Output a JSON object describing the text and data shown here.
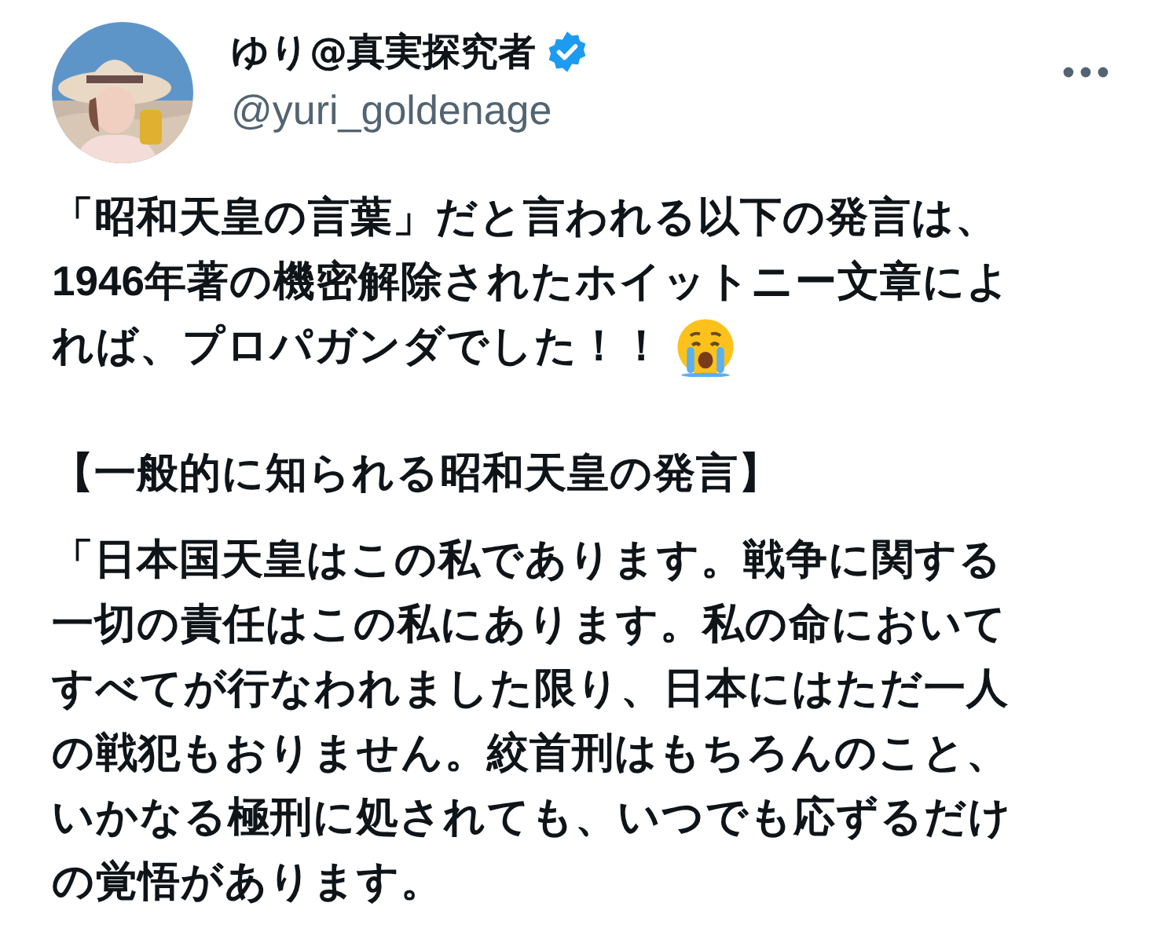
{
  "author": {
    "display_name": "ゆり@真実探究者",
    "verified": true,
    "handle": "@yuri_goldenage"
  },
  "paragraphs": [
    {
      "lines": [
        "「昭和天皇の言葉」だと言われる以下の発言は、",
        "1946年著の機密解除されたホイットニー文章によ",
        "れば、プロパガンダでした！！"
      ],
      "ends_with_emoji": true
    },
    {
      "lines": [
        "【一般的に知られる昭和天皇の発言】"
      ],
      "ends_with_emoji": false
    },
    {
      "lines": [
        "「日本国天皇はこの私であります。戦争に関する",
        "一切の責任はこの私にあります。私の命において",
        "すべてが行なわれました限り、日本にはただ一人",
        "の戦犯もおりません。絞首刑はもちろんのこと、",
        "いかなる極刑に処されても、いつでも応ずるだけ",
        "の覚悟があります。"
      ],
      "ends_with_emoji": false
    }
  ]
}
